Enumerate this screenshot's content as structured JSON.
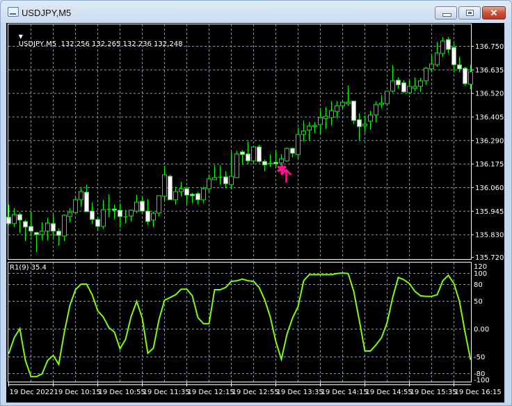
{
  "window": {
    "title": "USDJPY,M5",
    "buttons": {
      "minimize": "minimize",
      "maximize": "maximize",
      "close": "✕"
    }
  },
  "main_panel": {
    "header": "USDJPY,M5  132.256 132.265 132.236 132.248",
    "marker": {
      "type": "buy-arrow",
      "color": "#ff1493",
      "candle_index": 49
    }
  },
  "indicator_panel": {
    "header": "R1(9) 35.4"
  },
  "colors": {
    "background": "#000000",
    "candle": "#00ff00",
    "bear_fill": "#ffffff",
    "indicator_line": "#7fff00",
    "grid": "#8a9aaa",
    "axis_text": "#ffffff"
  },
  "chart_data": [
    {
      "type": "candlestick",
      "symbol": "USDJPY",
      "timeframe": "M5",
      "ylim": [
        135.72,
        136.8
      ],
      "y_ticks": [
        "136.750",
        "136.635",
        "136.520",
        "136.405",
        "136.290",
        "136.175",
        "136.060",
        "135.945",
        "135.830",
        "135.720"
      ],
      "x_ticks": [
        "19 Dec 2022",
        "19 Dec 10:15",
        "19 Dec 10:55",
        "19 Dec 11:35",
        "19 Dec 12:15",
        "19 Dec 12:55",
        "19 Dec 13:35",
        "19 Dec 14:15",
        "19 Dec 14:55",
        "19 Dec 15:35",
        "19 Dec 16:15"
      ],
      "grid": true,
      "ohlc": [
        [
          135.914,
          135.975,
          135.876,
          135.883
        ],
        [
          135.883,
          135.958,
          135.866,
          135.927
        ],
        [
          135.927,
          135.937,
          135.839,
          135.9
        ],
        [
          135.893,
          135.9,
          135.798,
          135.866
        ],
        [
          135.869,
          135.944,
          135.822,
          135.846
        ],
        [
          135.839,
          135.842,
          135.744,
          135.829
        ],
        [
          135.829,
          135.89,
          135.801,
          135.846
        ],
        [
          135.846,
          135.91,
          135.801,
          135.886
        ],
        [
          135.883,
          135.927,
          135.818,
          135.846
        ],
        [
          135.846,
          135.859,
          135.774,
          135.825
        ],
        [
          135.822,
          135.927,
          135.798,
          135.924
        ],
        [
          135.917,
          135.958,
          135.89,
          135.937
        ],
        [
          135.937,
          136.009,
          135.927,
          135.999
        ],
        [
          135.999,
          136.056,
          135.965,
          136.039
        ],
        [
          136.036,
          136.073,
          135.941,
          135.941
        ],
        [
          135.944,
          135.985,
          135.88,
          135.903
        ],
        [
          135.903,
          135.914,
          135.856,
          135.869
        ],
        [
          135.869,
          135.999,
          135.856,
          135.951
        ],
        [
          135.951,
          136.026,
          135.914,
          135.954
        ],
        [
          135.954,
          135.975,
          135.903,
          135.948
        ],
        [
          135.948,
          135.982,
          135.863,
          135.917
        ],
        [
          135.917,
          135.951,
          135.883,
          135.914
        ],
        [
          135.92,
          135.951,
          135.893,
          135.948
        ],
        [
          135.944,
          136.022,
          135.934,
          135.988
        ],
        [
          135.992,
          136.009,
          135.934,
          135.944
        ],
        [
          135.944,
          136.002,
          135.876,
          135.893
        ],
        [
          135.9,
          135.941,
          135.866,
          135.934
        ],
        [
          135.934,
          136.019,
          135.917,
          136.019
        ],
        [
          136.016,
          136.165,
          135.995,
          136.121
        ],
        [
          136.114,
          136.121,
          135.999,
          135.999
        ],
        [
          135.999,
          136.063,
          135.975,
          136.039
        ],
        [
          136.039,
          136.087,
          136.016,
          136.053
        ],
        [
          136.053,
          136.063,
          135.975,
          136.022
        ],
        [
          136.026,
          136.033,
          135.982,
          136.019
        ],
        [
          136.029,
          136.036,
          135.978,
          135.999
        ],
        [
          135.999,
          136.063,
          135.982,
          136.053
        ],
        [
          136.053,
          136.124,
          136.039,
          136.101
        ],
        [
          136.097,
          136.169,
          136.097,
          136.107
        ],
        [
          136.107,
          136.169,
          136.073,
          136.111
        ],
        [
          136.111,
          136.138,
          136.06,
          136.077
        ],
        [
          136.073,
          136.233,
          136.053,
          136.114
        ],
        [
          136.107,
          136.237,
          136.107,
          136.223
        ],
        [
          136.233,
          136.243,
          136.172,
          136.22
        ],
        [
          136.223,
          136.284,
          136.172,
          136.189
        ],
        [
          136.189,
          136.264,
          136.179,
          136.257
        ],
        [
          136.257,
          136.267,
          136.179,
          136.186
        ],
        [
          136.186,
          136.196,
          136.138,
          136.169
        ],
        [
          136.179,
          136.22,
          136.162,
          136.175
        ],
        [
          136.182,
          136.243,
          136.158,
          136.175
        ],
        [
          136.179,
          136.223,
          136.158,
          136.199
        ],
        [
          136.189,
          136.254,
          136.186,
          136.25
        ],
        [
          136.25,
          136.254,
          136.206,
          136.226
        ],
        [
          136.22,
          136.352,
          136.199,
          136.318
        ],
        [
          136.318,
          136.386,
          136.284,
          136.335
        ],
        [
          136.339,
          136.379,
          136.288,
          136.359
        ],
        [
          136.356,
          136.379,
          136.325,
          136.362
        ],
        [
          136.366,
          136.447,
          136.322,
          136.4
        ],
        [
          136.396,
          136.451,
          136.345,
          136.407
        ],
        [
          136.4,
          136.481,
          136.362,
          136.434
        ],
        [
          136.43,
          136.481,
          136.396,
          136.458
        ],
        [
          136.458,
          136.478,
          136.444,
          136.475
        ],
        [
          136.468,
          136.556,
          136.458,
          136.475
        ],
        [
          136.481,
          136.481,
          136.369,
          136.386
        ],
        [
          136.39,
          136.42,
          136.291,
          136.356
        ],
        [
          136.359,
          136.41,
          136.328,
          136.369
        ],
        [
          136.383,
          136.434,
          136.342,
          136.413
        ],
        [
          136.413,
          136.481,
          136.376,
          136.464
        ],
        [
          136.464,
          136.509,
          136.447,
          136.471
        ],
        [
          136.468,
          136.529,
          136.464,
          136.529
        ],
        [
          136.529,
          136.658,
          136.522,
          136.58
        ],
        [
          136.583,
          136.597,
          136.543,
          136.56
        ],
        [
          136.57,
          136.583,
          136.519,
          136.526
        ],
        [
          136.522,
          136.59,
          136.515,
          136.553
        ],
        [
          136.543,
          136.597,
          136.529,
          136.553
        ],
        [
          136.553,
          136.594,
          136.526,
          136.58
        ],
        [
          136.58,
          136.648,
          136.56,
          136.641
        ],
        [
          136.638,
          136.713,
          136.621,
          136.662
        ],
        [
          136.658,
          136.77,
          136.648,
          136.716
        ],
        [
          136.713,
          136.794,
          136.696,
          136.774
        ],
        [
          136.781,
          136.794,
          136.713,
          136.733
        ],
        [
          136.743,
          136.764,
          136.624,
          136.658
        ],
        [
          136.658,
          136.696,
          136.621,
          136.638
        ],
        [
          136.641,
          136.648,
          136.556,
          136.566
        ],
        [
          136.563,
          136.658,
          136.539,
          136.624
        ]
      ]
    },
    {
      "type": "line",
      "name": "R1(9)",
      "ylim": [
        -100,
        120
      ],
      "y_ticks": [
        "120",
        "100",
        "80",
        "50",
        "0.00",
        "-50",
        "-80",
        "-100"
      ],
      "grid_levels": [
        100,
        80,
        50,
        0,
        -50,
        -80
      ],
      "values": [
        -45,
        -16,
        0,
        -57,
        -86,
        -86,
        -81,
        -57,
        -48,
        -64,
        -6,
        42,
        70,
        80,
        80,
        61,
        32,
        21,
        2,
        -6,
        -36,
        -19,
        22,
        49,
        19,
        -44,
        -35,
        16,
        51,
        56,
        61,
        71,
        71,
        59,
        20,
        9,
        9,
        70,
        70,
        74,
        85,
        86,
        89,
        86,
        85,
        74,
        52,
        21,
        -23,
        -55,
        -10,
        19,
        40,
        86,
        97,
        97,
        97,
        97,
        97,
        99,
        100,
        99,
        67,
        15,
        -40,
        -40,
        -29,
        -16,
        11,
        56,
        92,
        88,
        81,
        67,
        59,
        58,
        58,
        61,
        86,
        96,
        81,
        49,
        -6,
        -56
      ]
    }
  ]
}
